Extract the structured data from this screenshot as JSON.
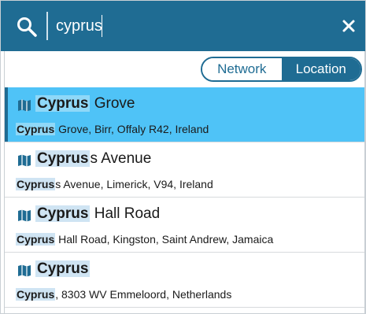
{
  "search": {
    "query": "cyprus"
  },
  "toggle": {
    "network_label": "Network",
    "location_label": "Location",
    "active": "Location"
  },
  "results": [
    {
      "match": "Cyprus",
      "title_rest": " Grove",
      "address_rest": " Grove, Birr, Offaly R42, Ireland",
      "selected": true
    },
    {
      "match": "Cyprus",
      "title_rest": "s Avenue",
      "address_rest": "s Avenue, Limerick, V94, Ireland",
      "selected": false
    },
    {
      "match": "Cyprus",
      "title_rest": " Hall Road",
      "address_rest": " Hall Road, Kingston, Saint Andrew, Jamaica",
      "selected": false
    },
    {
      "match": "Cyprus",
      "title_rest": "",
      "address_rest": ", 8303 WV Emmeloord, Netherlands",
      "selected": false
    }
  ],
  "icons": {
    "search": "search-icon",
    "close": "close-icon",
    "result": "map-icon"
  },
  "colors": {
    "header": "#1f6c93",
    "selected_row": "#4fc3f7",
    "highlight": "#cfe4f3"
  }
}
